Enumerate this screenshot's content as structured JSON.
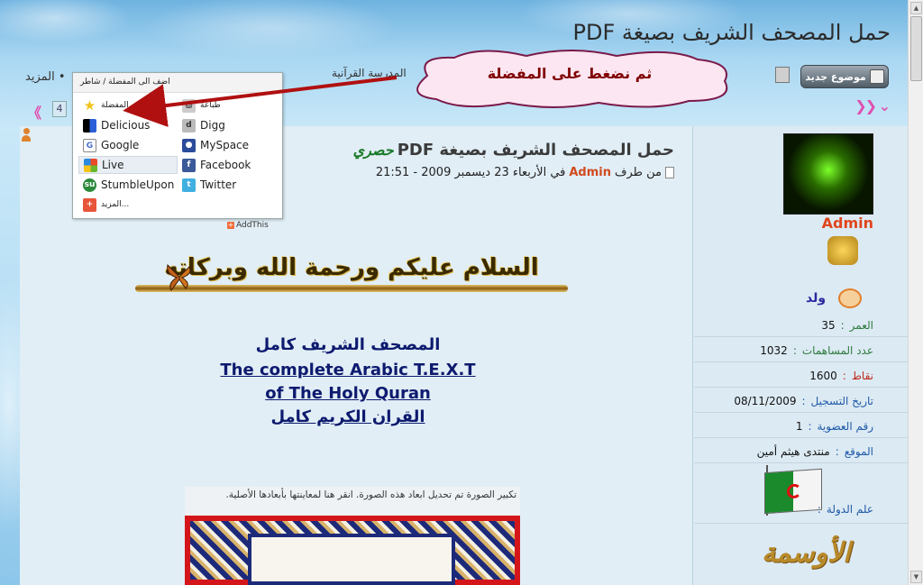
{
  "page": {
    "title": "حمل المصحف الشريف بصيغة PDF"
  },
  "toolbar": {
    "new_topic_label": "موضوع جديد",
    "breadcrumb": "المدرسة القرآنية",
    "more_label": "• المزيد",
    "page_number": "4",
    "nav_prev": "《",
    "nav_next": "❯❯ ⌄"
  },
  "callout": {
    "text": "ثم نضغط على المفضلة"
  },
  "share_menu": {
    "header": "اضف الى المفضلة / شاطر",
    "items": [
      {
        "label": "المفضلة",
        "icon": "star-icon",
        "color": "#f2c21a"
      },
      {
        "label": "طباعة",
        "icon": "printer-icon",
        "color": "#9a9a9a"
      },
      {
        "label": "Delicious",
        "icon": "delicious-icon",
        "color": "#2a5fd8"
      },
      {
        "label": "Digg",
        "icon": "digg-icon",
        "color": "#8a8a8a"
      },
      {
        "label": "Google",
        "icon": "google-icon",
        "color": "#4a6fd0"
      },
      {
        "label": "MySpace",
        "icon": "myspace-icon",
        "color": "#2a4c9a"
      },
      {
        "label": "Live",
        "icon": "windows-live-icon",
        "color": "#e28a20"
      },
      {
        "label": "Facebook",
        "icon": "facebook-icon",
        "color": "#3b5a98"
      },
      {
        "label": "StumbleUpon",
        "icon": "stumbleupon-icon",
        "color": "#2a8a3a"
      },
      {
        "label": "Twitter",
        "icon": "twitter-icon",
        "color": "#3fb0e0"
      },
      {
        "label": "المزيد...",
        "icon": "more-plus-icon",
        "color": "#e8553a"
      }
    ],
    "footer": "AddThis"
  },
  "post": {
    "tag": "حصري",
    "title": "حمل المصحف الشريف بصيغة PDF",
    "meta_prefix": "من طرف",
    "author": "Admin",
    "meta_date": "في الأربعاء 23 ديسمبر 2009 - 21:51",
    "greeting": "السلام عليكم ورحمة الله وبركاته",
    "body_lines": [
      "المصحف الشريف كامل",
      "The complete Arabic T.E.X.T",
      "of The Holy Quran",
      "القران الكريم كامل"
    ],
    "image_caption": "تكبير الصورة تم تحديل ابعاد هذه الصورة. انقر هنا لمعاينتها بأبعادها الأصلية."
  },
  "profile": {
    "username": "Admin",
    "gender": "ولد",
    "fields": [
      {
        "key": "العمر",
        "value": "35"
      },
      {
        "key": "عدد المساهمات",
        "value": "1032"
      },
      {
        "key": "نقاط",
        "value": "1600"
      },
      {
        "key": "تاريخ التسجيل",
        "value": "08/11/2009"
      },
      {
        "key": "رقم العضوية",
        "value": "1"
      },
      {
        "key": "الموقع",
        "value": "منتدى هيثم أمين"
      }
    ],
    "flag_label": "علم الدولة",
    "decoration_text": "الأوسمة"
  }
}
